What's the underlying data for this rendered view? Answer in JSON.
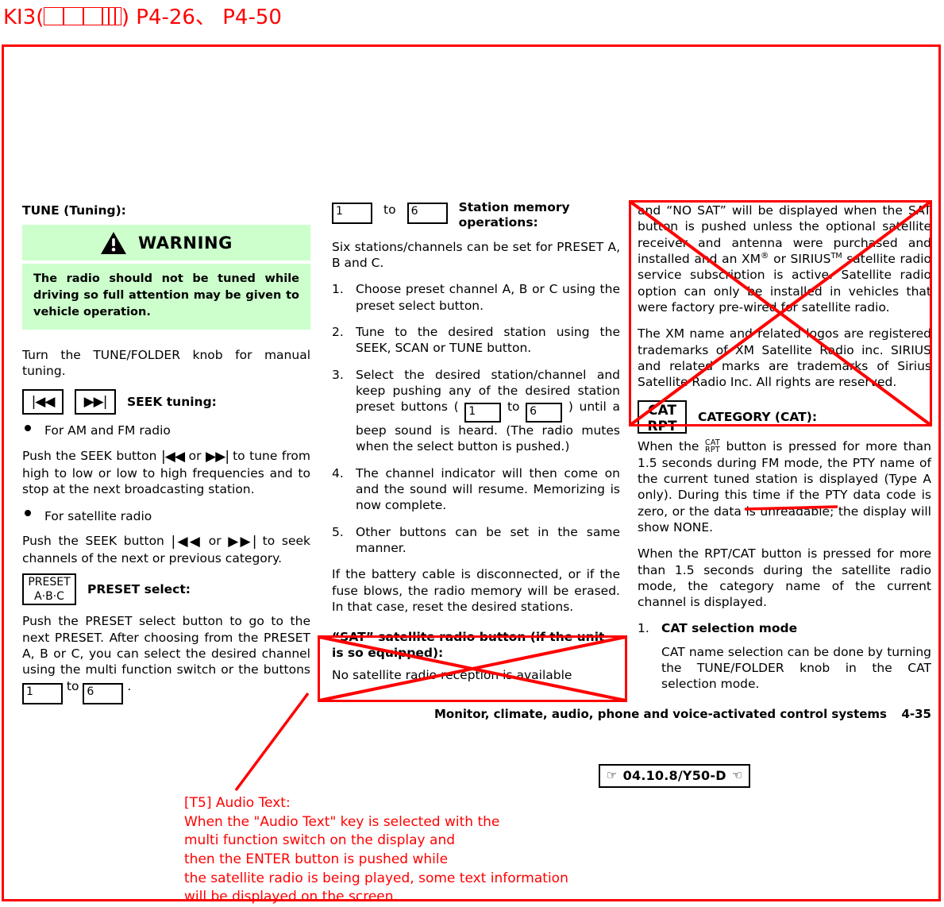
{
  "header": {
    "annotation_prefix": "KI3(",
    "annotation_suffix": ") P4-26、 P4-50",
    "tofu_count": 6
  },
  "left_column": {
    "tune_heading": "TUNE (Tuning):",
    "warning": {
      "title": "WARNING",
      "icon": "warning-triangle-icon",
      "body": "The radio should not be tuned while driving so full attention may be given to vehicle operation.",
      "bg_color": "#ccffcc"
    },
    "tune_paragraph": "Turn the TUNE/FOLDER knob for manual tuning.",
    "seek_heading": "SEEK tuning:",
    "seek_prev_glyph": "|◀◀",
    "seek_next_glyph": "▶▶|",
    "bullet_am_fm": "For AM and FM radio",
    "am_fm_text_1": "Push the SEEK button ",
    "am_fm_text_or": " or ",
    "am_fm_text_2": " to tune from high to low or low to high frequencies and to stop at the next broadcasting station.",
    "bullet_satellite": "For satellite radio",
    "sat_text_2": " to seek channels of the next or previous category.",
    "preset_key_line1": "PRESET",
    "preset_key_line2": "A·B·C",
    "preset_heading": "PRESET select:",
    "preset_text_1": "Push the PRESET select button to go to the next PRESET. After choosing from the PRESET A, B or C, you can select the desired channel using the multi function switch or the buttons ",
    "preset_text_to": " to ",
    "preset_text_end": " .",
    "key_1": "1",
    "key_6": "6"
  },
  "middle_column": {
    "station_memory_heading": "Station memory operations:",
    "key_1": "1",
    "key_6": "6",
    "to_label": "to",
    "intro": "Six stations/channels can be set for PRESET A, B and C.",
    "steps": [
      {
        "num": "1.",
        "text": "Choose preset channel A, B or C using the preset select button."
      },
      {
        "num": "2.",
        "text": "Tune to the desired station using the SEEK, SCAN or TUNE button."
      },
      {
        "num": "3.",
        "text_before": "Select the desired station/channel and keep pushing any of the desired station preset buttons ( ",
        "text_mid": " to ",
        "text_after": " ) until a beep sound is heard. (The radio mutes when the select button is pushed.)"
      },
      {
        "num": "4.",
        "text": "The channel indicator will then come on and the sound will resume. Memorizing is now complete."
      },
      {
        "num": "5.",
        "text": "Other buttons can be set in the same manner."
      }
    ],
    "battery_note": "If the battery cable is disconnected, or if the fuse blows, the radio memory will be erased. In that case, reset the desired stations.",
    "sat_heading": "“SAT” satellite radio button (if the unit is so equipped):",
    "sat_text": "No satellite radio reception is available"
  },
  "right_column": {
    "sat_continued": "and “NO SAT” will be displayed when the SAT button is pushed unless the optional satellite receiver and antenna were purchased and installed and an XM",
    "sat_continued_2": " or SIRIUS",
    "sat_continued_3": " satellite radio service subscription is active. Satellite radio option can only be installed in vehicles that were factory pre-wired for satellite radio.",
    "reg_mark": "®",
    "tm_mark": "TM",
    "trademark_note": "The XM name and related logos are registered trademarks of XM Satellite Radio inc. SIRIUS and related marks are trademarks of Sirius Satellite Radio Inc. All rights are reserved.",
    "cat_key_line1": "CAT",
    "cat_key_line2": "RPT",
    "category_heading": "CATEGORY (CAT):",
    "cat_text_before": "When the ",
    "cat_text_after_1": " button is pressed for more than 1.5 seconds during FM mode, the PTY name of the current tuned station is displayed ",
    "cat_struck": "(Type A only)",
    "cat_text_after_2": ". During this time if the PTY data code is zero, or the data is unreadable; the display will show NONE.",
    "rpt_text": "When the RPT/CAT button is pressed for more than 1.5 seconds during the satellite radio mode, the category name of the current channel is displayed.",
    "cat_mode_num": "1.",
    "cat_mode_heading": "CAT selection mode",
    "cat_mode_text": "CAT name selection can be done by turning the TUNE/FOLDER knob in the CAT selection mode."
  },
  "footer": {
    "section_title": "Monitor, climate, audio, phone and voice-activated control systems",
    "page_number": "4-35",
    "date_stamp": "04.10.8/Y50-D",
    "hand_left": "☞",
    "hand_right": "☜"
  },
  "bottom_annotation": {
    "text": "[T5] Audio Text:\nWhen the \"Audio Text\" key is selected with the\nmulti function switch on the display and\nthen the ENTER button is pushed while\nthe satellite radio is being played, some text information\nwill be displayed on the screen."
  },
  "colors": {
    "markup_red": "#ff0000",
    "warning_green": "#ccffcc",
    "text_black": "#000000"
  }
}
